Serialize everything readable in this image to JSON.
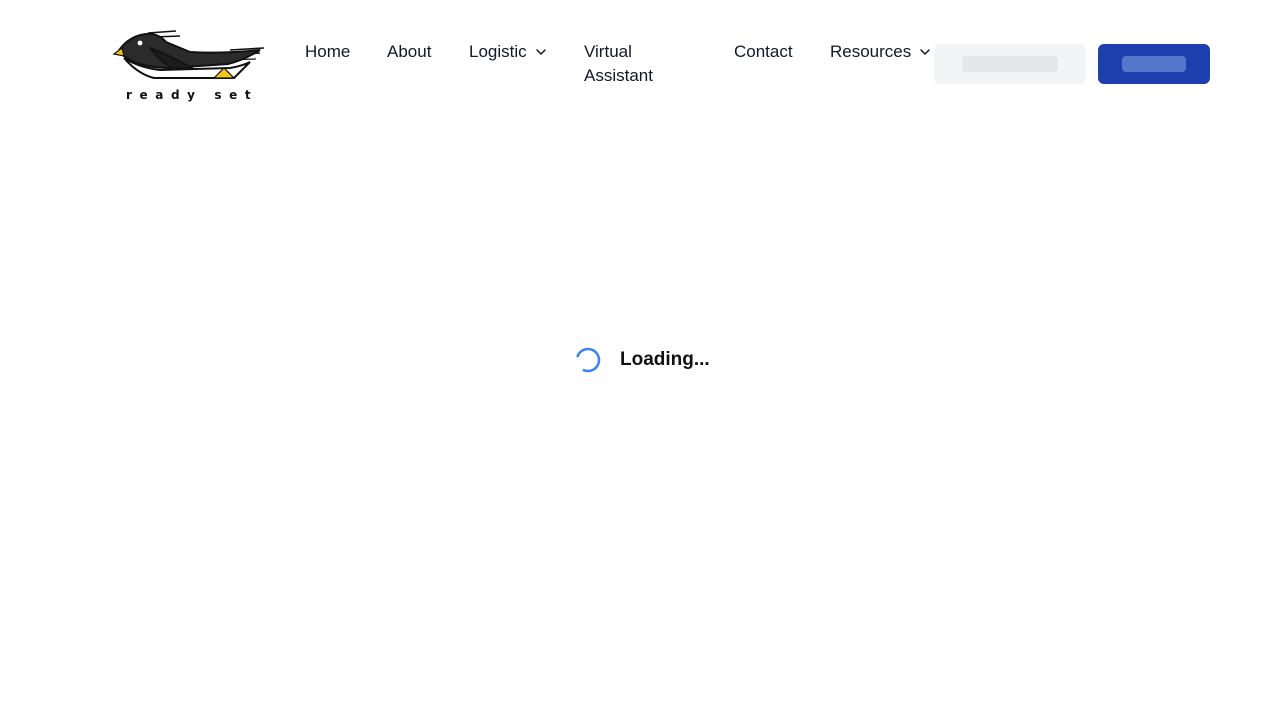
{
  "logo": {
    "wordmark": "ready set",
    "colors": {
      "body": "#2b2b2b",
      "belly": "#ffffff",
      "feet": "#f5c518"
    }
  },
  "nav": {
    "items": [
      {
        "label": "Home",
        "has_dropdown": false
      },
      {
        "label": "About",
        "has_dropdown": false
      },
      {
        "label": "Logistic",
        "has_dropdown": true,
        "icon": "chevron-down-icon"
      },
      {
        "label": "Virtual Assistant",
        "has_dropdown": false
      },
      {
        "label": "Contact",
        "has_dropdown": false
      },
      {
        "label": "Resources",
        "has_dropdown": true,
        "icon": "chevron-down-icon"
      }
    ]
  },
  "actions": {
    "secondary_button": {
      "state": "loading-skeleton",
      "color": "#f3f4f6"
    },
    "primary_button": {
      "state": "loading-skeleton",
      "color": "#1e40af"
    }
  },
  "main": {
    "loading_text": "Loading...",
    "spinner_icon": "spinner-icon",
    "spinner_color": "#3b82f6"
  }
}
